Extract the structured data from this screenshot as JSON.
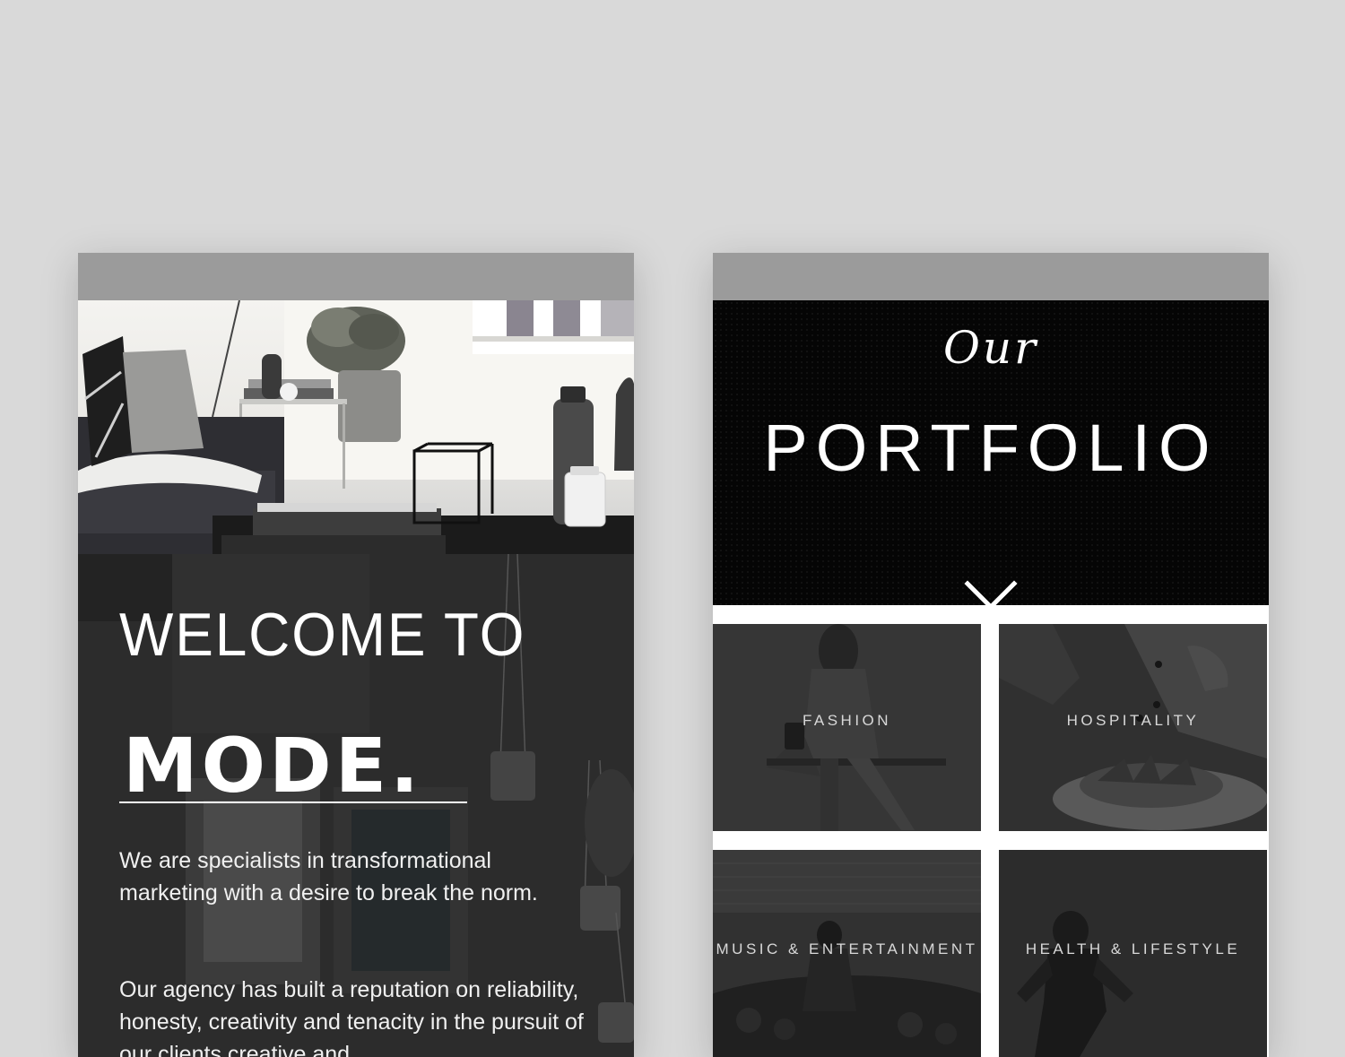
{
  "left_screen": {
    "headline_line1": "WELCOME TO",
    "headline_line2": "MODE.",
    "paragraphs": [
      "We are specialists in transformational marketing with a desire to break the norm.",
      "Our agency has built a reputation on reliability, honesty, creativity and tenacity in the pursuit of our clients creative and"
    ]
  },
  "right_screen": {
    "title_script": "Our",
    "title_main": "PORTFOLIO",
    "scroll_icon": "chevron-down-icon",
    "tiles": [
      {
        "label": "FASHION"
      },
      {
        "label": "HOSPITALITY"
      },
      {
        "label": "MUSIC & ENTERTAINMENT"
      },
      {
        "label": "HEALTH & LIFESTYLE"
      }
    ]
  },
  "colors": {
    "background": "#d9d9d9",
    "status_bar": "#9b9b9b",
    "portfolio_header": "#050505",
    "dark_panel": "#2b2b2b",
    "text_light": "#ffffff"
  }
}
